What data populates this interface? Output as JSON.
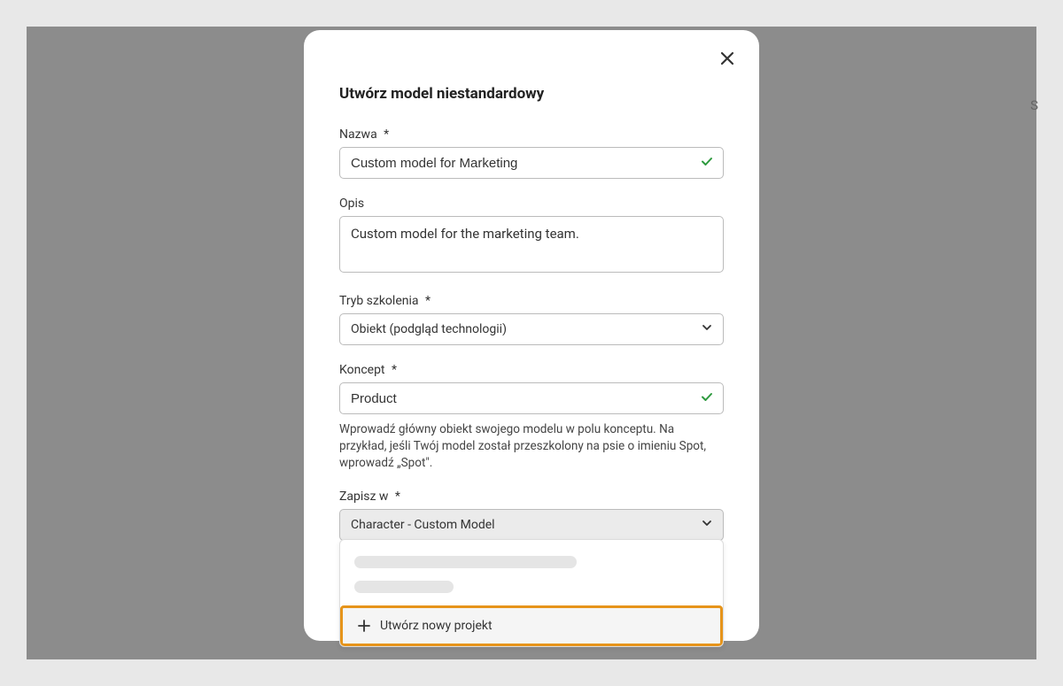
{
  "modal": {
    "title": "Utwórz model niestandardowy",
    "close_label": "Close"
  },
  "fields": {
    "name": {
      "label": "Nazwa",
      "value": "Custom model for Marketing",
      "required": "*"
    },
    "description": {
      "label": "Opis",
      "value": "Custom model for the marketing team."
    },
    "training_mode": {
      "label": "Tryb szkolenia",
      "required": "*",
      "selected": "Obiekt (podgląd technologii)"
    },
    "concept": {
      "label": "Koncept",
      "required": "*",
      "value": "Product",
      "help": "Wprowadź główny obiekt swojego modelu w polu konceptu. Na przykład, jeśli Twój model został przeszkolony na psie o imieniu Spot, wprowadź „Spot\"."
    },
    "save_in": {
      "label": "Zapisz w",
      "required": "*",
      "selected": "Character - Custom Model"
    }
  },
  "dropdown": {
    "new_project": "Utwórz nowy projekt"
  },
  "peek": "S"
}
